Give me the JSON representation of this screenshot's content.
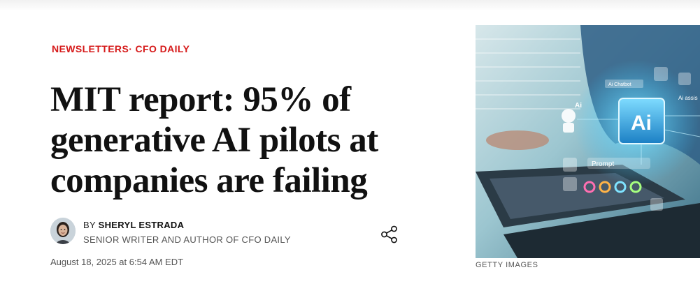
{
  "breadcrumb": {
    "section": "NEWSLETTERS",
    "separator": "·",
    "subsection": "CFO DAILY"
  },
  "headline": "MIT report: 95% of generative AI pilots at companies are failing",
  "byline": {
    "prefix": "BY",
    "author": "SHERYL ESTRADA",
    "role": "SENIOR WRITER AND AUTHOR OF CFO DAILY"
  },
  "date": "August 18, 2025 at 6:54 AM EDT",
  "image": {
    "overlay_texts": {
      "ai_chatbot": "Ai Chatbot",
      "ai_big": "Ai",
      "ai_small": "Ai",
      "prompt": "Prompt",
      "ai_assist": "Ai assis"
    },
    "credit": "GETTY IMAGES"
  },
  "icons": {
    "share": "share-icon"
  },
  "colors": {
    "accent": "#d61a1a",
    "headline": "#111111",
    "meta": "#555555",
    "hero_glow": "#39c6ff"
  }
}
